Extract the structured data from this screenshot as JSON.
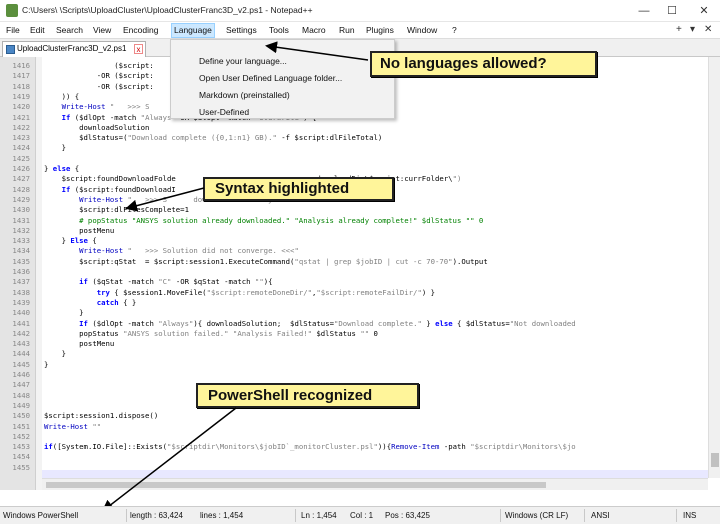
{
  "window": {
    "title": "C:\\Users\\                                    \\Scripts\\UploadCluster\\UploadClusterFranc3D_v2.ps1 - Notepad++",
    "minimize": "—",
    "maximize": "☐",
    "close": "✕"
  },
  "menu": {
    "items": [
      "File",
      "Edit",
      "Search",
      "View",
      "Encoding",
      "Language",
      "Settings",
      "Tools",
      "Macro",
      "Run",
      "Plugins",
      "Window",
      "?"
    ],
    "right_plus": "+",
    "right_down": "▾",
    "right_close": "✕"
  },
  "tab": {
    "label": "UploadClusterFranc3D_v2.ps1",
    "close": "x"
  },
  "language_menu": {
    "items": [
      "Define your language...",
      "Open User Defined Language folder...",
      "Markdown (preinstalled)",
      "User-Defined"
    ]
  },
  "code_lines": [
    {
      "n": "1416",
      "t": "                ($script:"
    },
    {
      "n": "1417",
      "t": "            -OR ($script:"
    },
    {
      "n": "1418",
      "t": "            -OR ($script:"
    },
    {
      "n": "1419",
      "t": "    )) {"
    },
    {
      "n": "1420",
      "t": "    Write-Host \"   >>> S"
    },
    {
      "n": "1421",
      "t": "    If ($dlOpt -match \"Always\"-OR $dlOpt -match \"Overwrite\") {"
    },
    {
      "n": "1422",
      "t": "        downloadSolution"
    },
    {
      "n": "1423",
      "t": "        $dlStatus=(\"Download complete ({0,1:n1} GB).\" -f $script:dlFileTotal)"
    },
    {
      "n": "1424",
      "t": "    }"
    },
    {
      "n": "1425",
      "t": ""
    },
    {
      "n": "1426",
      "t": "} else {"
    },
    {
      "n": "1427",
      "t": "    $script:foundDownloadFolde                               :downloadDir\\$script:currFolder\\\")"
    },
    {
      "n": "1428",
      "t": "    If ($script:foundDownloadI"
    },
    {
      "n": "1429",
      "t": "        Write-Host \"   >>> S      downloaded already. <<<\""
    },
    {
      "n": "1430",
      "t": "        $script:dlFilesComplete=1"
    },
    {
      "n": "1431",
      "t": "        # popStatus \"ANSYS solution already downloaded.\" \"Analysis already complete!\" $dlStatus \"\" 0"
    },
    {
      "n": "1432",
      "t": "        postMenu"
    },
    {
      "n": "1433",
      "t": "    } Else {"
    },
    {
      "n": "1434",
      "t": "        Write-Host \"   >>> Solution did not converge. <<<\""
    },
    {
      "n": "1435",
      "t": "        $script:qStat  = $script:session1.ExecuteCommand(\"qstat | grep $jobID | cut -c 70-70\").Output"
    },
    {
      "n": "1436",
      "t": ""
    },
    {
      "n": "1437",
      "t": "        if ($qStat -match \"C\" -OR $qStat -match \"\"){"
    },
    {
      "n": "1438",
      "t": "            try { $session1.MoveFile(\"$script:remoteDoneDir/\",\"$script:remoteFailDir/\") }"
    },
    {
      "n": "1439",
      "t": "            catch { }"
    },
    {
      "n": "1440",
      "t": "        }"
    },
    {
      "n": "1441",
      "t": "        If ($dlOpt -match \"Always\"){ downloadSolution;  $dlStatus=\"Download complete.\" } else { $dlStatus=\"Not downloaded"
    },
    {
      "n": "1442",
      "t": "        popStatus \"ANSYS solution failed.\" \"Analysis Failed!\" $dlStatus \"\" 0"
    },
    {
      "n": "1443",
      "t": "        postMenu"
    },
    {
      "n": "1444",
      "t": "    }"
    },
    {
      "n": "1445",
      "t": "}"
    },
    {
      "n": "1446",
      "t": ""
    },
    {
      "n": "1447",
      "t": ""
    },
    {
      "n": "1448",
      "t": ""
    },
    {
      "n": "1449",
      "t": ""
    },
    {
      "n": "1450",
      "t": "$script:session1.dispose()"
    },
    {
      "n": "1451",
      "t": "Write-Host \"\""
    },
    {
      "n": "1452",
      "t": ""
    },
    {
      "n": "1453",
      "t": "if([System.IO.File]::Exists(\"$scriptdir\\Monitors\\$jobID`_monitorCluster.psl\")){Remove-Item -path \"$scriptdir\\Monitors\\$jo"
    },
    {
      "n": "1454",
      "t": ""
    },
    {
      "n": "1455",
      "t": ""
    }
  ],
  "callouts": {
    "languages": "No languages allowed?",
    "syntax": "Syntax highlighted",
    "powershell": "PowerShell recognized"
  },
  "status": {
    "language": "Windows PowerShell",
    "length": "length : 63,424",
    "lines": "lines : 1,454",
    "ln": "Ln : 1,454",
    "col": "Col : 1",
    "pos": "Pos : 63,425",
    "eol": "Windows (CR LF)",
    "encoding": "ANSI",
    "mode": "INS"
  },
  "colors": {
    "callout_bg": "#fff59a",
    "keyword": "#0000ff",
    "string": "#808080",
    "comment": "#008000",
    "menu_highlight": "#cce8ff"
  }
}
